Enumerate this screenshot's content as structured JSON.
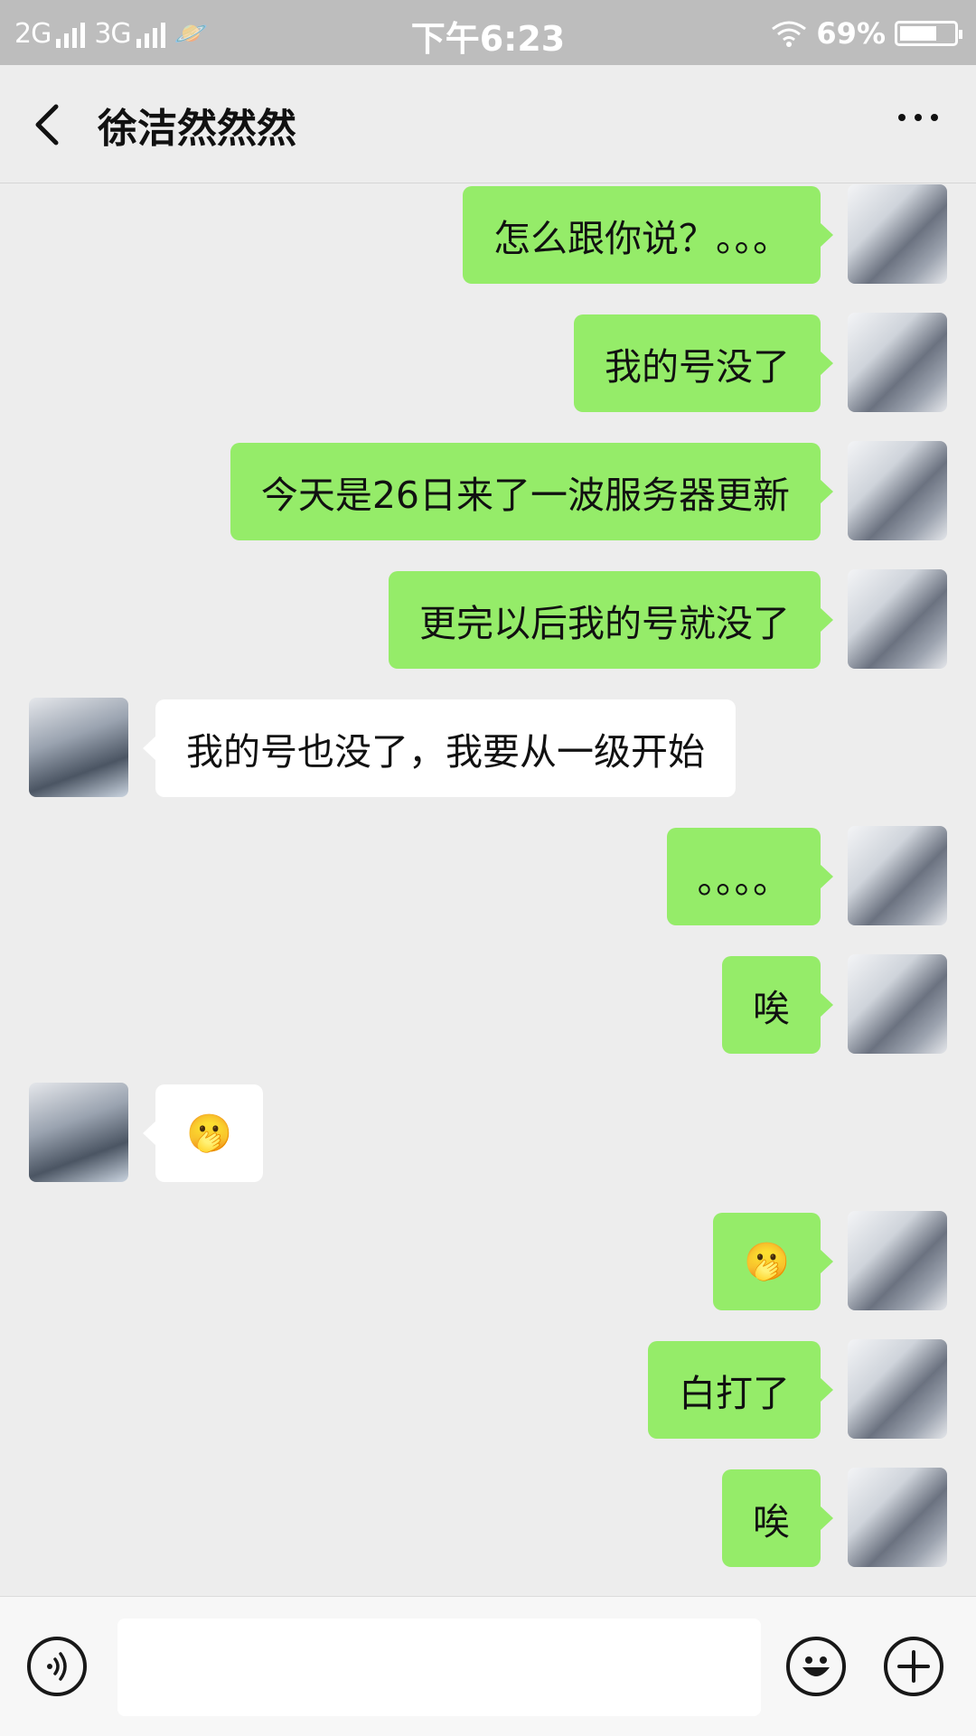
{
  "status_bar": {
    "network_left": "2G",
    "network_right": "3G",
    "time": "下午6:23",
    "battery": "69%",
    "battery_level": 0.69
  },
  "header": {
    "title": "徐洁然然然"
  },
  "messages": [
    {
      "sender": "me",
      "text": "怎么跟你说？。。。"
    },
    {
      "sender": "me",
      "text": "我的号没了"
    },
    {
      "sender": "me",
      "text": "今天是26日来了一波服务器更新"
    },
    {
      "sender": "me",
      "text": "更完以后我的号就没了"
    },
    {
      "sender": "them",
      "text": "我的号也没了，我要从一级开始"
    },
    {
      "sender": "me",
      "text": "。。。。"
    },
    {
      "sender": "me",
      "text": "唉"
    },
    {
      "sender": "them",
      "text": "🫢"
    },
    {
      "sender": "me",
      "text": "🫢"
    },
    {
      "sender": "me",
      "text": "白打了"
    },
    {
      "sender": "me",
      "text": "唉"
    }
  ],
  "input": {
    "placeholder": ""
  },
  "icons": {
    "back": "chevron-left-icon",
    "more": "more-icon",
    "voice": "voice-icon",
    "emoji": "emoji-icon",
    "plus": "plus-icon"
  }
}
